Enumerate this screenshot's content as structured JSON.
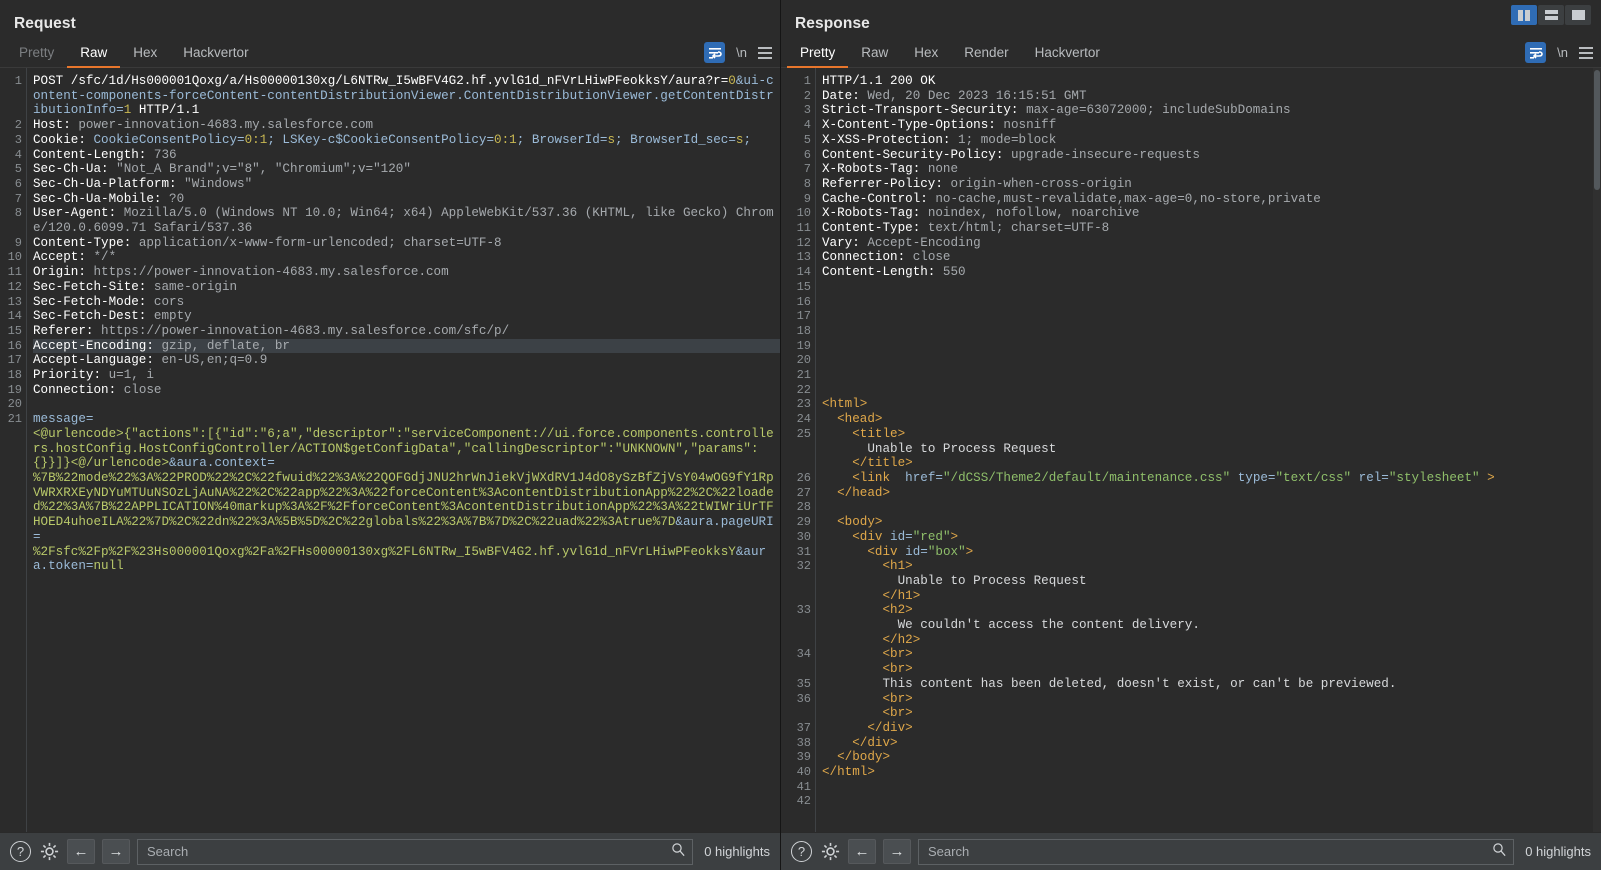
{
  "window": {
    "layout_buttons": [
      {
        "name": "split-vertical",
        "active": true
      },
      {
        "name": "split-horizontal",
        "active": false
      },
      {
        "name": "single-pane",
        "active": false
      }
    ]
  },
  "request": {
    "title": "Request",
    "tabs": [
      {
        "label": "Pretty",
        "active": false,
        "muted": true
      },
      {
        "label": "Raw",
        "active": true,
        "muted": false
      },
      {
        "label": "Hex",
        "active": false,
        "muted": false
      },
      {
        "label": "Hackvertor",
        "active": false,
        "muted": false
      }
    ],
    "tools": {
      "wrap_icon": "word-wrap-icon",
      "newline_label": "\\n",
      "menu_icon": "hamburger-menu-icon"
    },
    "search": {
      "placeholder": "Search",
      "value": "",
      "highlights": "0 highlights"
    },
    "lines": [
      {
        "n": 1,
        "segments": [
          {
            "t": "POST /sfc/1d/Hs000001Qoxg/a/Hs00000130xg/L6NTRw_I5wBFV4G2.hf.yvlG1d_nFVrLHiwPFeokksY/aura?r=",
            "c": "k"
          },
          {
            "t": "0",
            "c": "num"
          },
          {
            "t": "&ui-content-components-forceContent-contentDistributionViewer.ContentDistributionViewer.getContentDistributionInfo=",
            "c": "attr"
          },
          {
            "t": "1",
            "c": "num"
          },
          {
            "t": " HTTP/1.1",
            "c": "k"
          }
        ]
      },
      {
        "n": 2,
        "segments": [
          {
            "t": "Host: ",
            "c": "k"
          },
          {
            "t": "power-innovation-4683.my.salesforce.com",
            "c": "v"
          }
        ]
      },
      {
        "n": 3,
        "segments": [
          {
            "t": "Cookie: ",
            "c": "k"
          },
          {
            "t": "CookieConsentPolicy=",
            "c": "attr"
          },
          {
            "t": "0:1",
            "c": "num"
          },
          {
            "t": "; LSKey-c$CookieConsentPolicy=",
            "c": "attr"
          },
          {
            "t": "0:1",
            "c": "num"
          },
          {
            "t": "; BrowserId=",
            "c": "attr"
          },
          {
            "t": "s",
            "c": "num"
          },
          {
            "t": "; BrowserId_sec=",
            "c": "attr"
          },
          {
            "t": "s",
            "c": "num"
          },
          {
            "t": ";",
            "c": "attr"
          }
        ]
      },
      {
        "n": 4,
        "segments": [
          {
            "t": "Content-Length: ",
            "c": "k"
          },
          {
            "t": "736",
            "c": "v"
          }
        ]
      },
      {
        "n": 5,
        "segments": [
          {
            "t": "Sec-Ch-Ua: ",
            "c": "k"
          },
          {
            "t": "\"Not_A Brand\";v=\"8\", \"Chromium\";v=\"120\"",
            "c": "v"
          }
        ]
      },
      {
        "n": 6,
        "segments": [
          {
            "t": "Sec-Ch-Ua-Platform: ",
            "c": "k"
          },
          {
            "t": "\"Windows\"",
            "c": "v"
          }
        ]
      },
      {
        "n": 7,
        "segments": [
          {
            "t": "Sec-Ch-Ua-Mobile: ",
            "c": "k"
          },
          {
            "t": "?0",
            "c": "v"
          }
        ]
      },
      {
        "n": 8,
        "segments": [
          {
            "t": "User-Agent: ",
            "c": "k"
          },
          {
            "t": "Mozilla/5.0 (Windows NT 10.0; Win64; x64) AppleWebKit/537.36 (KHTML, like Gecko) Chrome/120.0.6099.71 Safari/537.36",
            "c": "v"
          }
        ]
      },
      {
        "n": 9,
        "segments": [
          {
            "t": "Content-Type: ",
            "c": "k"
          },
          {
            "t": "application/x-www-form-urlencoded; charset=UTF-8",
            "c": "v"
          }
        ]
      },
      {
        "n": 10,
        "segments": [
          {
            "t": "Accept: ",
            "c": "k"
          },
          {
            "t": "*/*",
            "c": "v"
          }
        ]
      },
      {
        "n": 11,
        "segments": [
          {
            "t": "Origin: ",
            "c": "k"
          },
          {
            "t": "https://power-innovation-4683.my.salesforce.com",
            "c": "v"
          }
        ]
      },
      {
        "n": 12,
        "segments": [
          {
            "t": "Sec-Fetch-Site: ",
            "c": "k"
          },
          {
            "t": "same-origin",
            "c": "v"
          }
        ]
      },
      {
        "n": 13,
        "segments": [
          {
            "t": "Sec-Fetch-Mode: ",
            "c": "k"
          },
          {
            "t": "cors",
            "c": "v"
          }
        ]
      },
      {
        "n": 14,
        "segments": [
          {
            "t": "Sec-Fetch-Dest: ",
            "c": "k"
          },
          {
            "t": "empty",
            "c": "v"
          }
        ]
      },
      {
        "n": 15,
        "segments": [
          {
            "t": "Referer: ",
            "c": "k"
          },
          {
            "t": "https://power-innovation-4683.my.salesforce.com/sfc/p/",
            "c": "v"
          }
        ]
      },
      {
        "n": 16,
        "highlight": true,
        "segments": [
          {
            "t": "Accept-Encoding: ",
            "c": "k"
          },
          {
            "t": "gzip, deflate, br",
            "c": "v"
          }
        ]
      },
      {
        "n": 17,
        "segments": [
          {
            "t": "Accept-Language: ",
            "c": "k"
          },
          {
            "t": "en-US,en;q=0.9",
            "c": "v"
          }
        ]
      },
      {
        "n": 18,
        "segments": [
          {
            "t": "Priority: ",
            "c": "k"
          },
          {
            "t": "u=1, i",
            "c": "v"
          }
        ]
      },
      {
        "n": 19,
        "segments": [
          {
            "t": "Connection: ",
            "c": "k"
          },
          {
            "t": "close",
            "c": "v"
          }
        ]
      },
      {
        "n": 20,
        "segments": []
      },
      {
        "n": 21,
        "segments": [
          {
            "t": "message=",
            "c": "attr"
          },
          {
            "t": "\n<@urlencode>{\"actions\":[{\"id\":\"6;a\",\"descriptor\":\"serviceComponent://ui.force.components.controllers.hostConfig.HostConfigController/ACTION$getConfigData\",\"callingDescriptor\":\"UNKNOWN\",\"params\":{}}]}<@/urlencode>",
            "c": "body-txt"
          },
          {
            "t": "&aura.context=",
            "c": "attr"
          },
          {
            "t": "\n%7B%22mode%22%3A%22PROD%22%2C%22fwuid%22%3A%22QOFGdjJNU2hrWnJiekVjWXdRV1J4dO8ySzBfZjVsY04wOG9fY1RpVWRXRXEyNDYuMTUuNSOzLjAuNA%22%2C%22app%22%3A%22forceContent%3AcontentDistributionApp%22%2C%22loaded%22%3A%7B%22APPLICATION%40markup%3A%2F%2FforceContent%3AcontentDistributionApp%22%3A%22tWIWriUrTFHOED4uhoeILA%22%7D%2C%22dn%22%3A%5B%5D%2C%22globals%22%3A%7B%7D%2C%22uad%22%3Atrue%7D",
            "c": "body-txt"
          },
          {
            "t": "&aura.pageURI=",
            "c": "attr"
          },
          {
            "t": "\n%2Fsfc%2Fp%2F%23Hs000001Qoxg%2Fa%2FHs00000130xg%2FL6NTRw_I5wBFV4G2.hf.yvlG1d_nFVrLHiwPFeokksY",
            "c": "body-txt"
          },
          {
            "t": "&aura.token=",
            "c": "attr"
          },
          {
            "t": "null",
            "c": "body-txt"
          }
        ]
      }
    ]
  },
  "response": {
    "title": "Response",
    "tabs": [
      {
        "label": "Pretty",
        "active": true,
        "muted": false
      },
      {
        "label": "Raw",
        "active": false,
        "muted": false
      },
      {
        "label": "Hex",
        "active": false,
        "muted": false
      },
      {
        "label": "Render",
        "active": false,
        "muted": false
      },
      {
        "label": "Hackvertor",
        "active": false,
        "muted": false
      }
    ],
    "tools": {
      "wrap_icon": "word-wrap-icon",
      "newline_label": "\\n",
      "menu_icon": "hamburger-menu-icon"
    },
    "search": {
      "placeholder": "Search",
      "value": "",
      "highlights": "0 highlights"
    },
    "lines": [
      {
        "n": 1,
        "segments": [
          {
            "t": "HTTP/1.1 ",
            "c": "k"
          },
          {
            "t": "200",
            "c": "k"
          },
          {
            "t": " OK",
            "c": "k"
          }
        ]
      },
      {
        "n": 2,
        "segments": [
          {
            "t": "Date: ",
            "c": "k"
          },
          {
            "t": "Wed, 20 Dec 2023 16:15:51 GMT",
            "c": "v"
          }
        ]
      },
      {
        "n": 3,
        "segments": [
          {
            "t": "Strict-Transport-Security: ",
            "c": "k"
          },
          {
            "t": "max-age=63072000; includeSubDomains",
            "c": "v"
          }
        ]
      },
      {
        "n": 4,
        "segments": [
          {
            "t": "X-Content-Type-Options: ",
            "c": "k"
          },
          {
            "t": "nosniff",
            "c": "v"
          }
        ]
      },
      {
        "n": 5,
        "segments": [
          {
            "t": "X-XSS-Protection: ",
            "c": "k"
          },
          {
            "t": "1; mode=block",
            "c": "v"
          }
        ]
      },
      {
        "n": 6,
        "segments": [
          {
            "t": "Content-Security-Policy: ",
            "c": "k"
          },
          {
            "t": "upgrade-insecure-requests",
            "c": "v"
          }
        ]
      },
      {
        "n": 7,
        "segments": [
          {
            "t": "X-Robots-Tag: ",
            "c": "k"
          },
          {
            "t": "none",
            "c": "v"
          }
        ]
      },
      {
        "n": 8,
        "segments": [
          {
            "t": "Referrer-Policy: ",
            "c": "k"
          },
          {
            "t": "origin-when-cross-origin",
            "c": "v"
          }
        ]
      },
      {
        "n": 9,
        "segments": [
          {
            "t": "Cache-Control: ",
            "c": "k"
          },
          {
            "t": "no-cache,must-revalidate,max-age=0,no-store,private",
            "c": "v"
          }
        ]
      },
      {
        "n": 10,
        "segments": [
          {
            "t": "X-Robots-Tag: ",
            "c": "k"
          },
          {
            "t": "noindex, nofollow, noarchive",
            "c": "v"
          }
        ]
      },
      {
        "n": 11,
        "segments": [
          {
            "t": "Content-Type: ",
            "c": "k"
          },
          {
            "t": "text/html; charset=UTF-8",
            "c": "v"
          }
        ]
      },
      {
        "n": 12,
        "segments": [
          {
            "t": "Vary: ",
            "c": "k"
          },
          {
            "t": "Accept-Encoding",
            "c": "v"
          }
        ]
      },
      {
        "n": 13,
        "segments": [
          {
            "t": "Connection: ",
            "c": "k"
          },
          {
            "t": "close",
            "c": "v"
          }
        ]
      },
      {
        "n": 14,
        "segments": [
          {
            "t": "Content-Length: ",
            "c": "k"
          },
          {
            "t": "550",
            "c": "v"
          }
        ]
      },
      {
        "n": 15,
        "segments": []
      },
      {
        "n": 16,
        "segments": []
      },
      {
        "n": 17,
        "segments": []
      },
      {
        "n": 18,
        "segments": []
      },
      {
        "n": 19,
        "segments": []
      },
      {
        "n": 20,
        "segments": []
      },
      {
        "n": 21,
        "segments": []
      },
      {
        "n": 22,
        "segments": []
      },
      {
        "n": 23,
        "segments": [
          {
            "t": "<html>",
            "c": "tag"
          }
        ]
      },
      {
        "n": 24,
        "segments": [
          {
            "t": "  <head>",
            "c": "tag"
          }
        ]
      },
      {
        "n": 25,
        "segments": [
          {
            "t": "    <title>",
            "c": "tag"
          },
          {
            "t": "\n      Unable to Process Request",
            "c": "txt"
          },
          {
            "t": "\n    </title>",
            "c": "tag"
          }
        ]
      },
      {
        "n": 26,
        "segments": [
          {
            "t": "    <link ",
            "c": "tag"
          },
          {
            "t": " href=",
            "c": "attr"
          },
          {
            "t": "\"/dCSS/Theme2/default/maintenance.css\"",
            "c": "str"
          },
          {
            "t": " type=",
            "c": "attr"
          },
          {
            "t": "\"text/css\"",
            "c": "str"
          },
          {
            "t": " rel=",
            "c": "attr"
          },
          {
            "t": "\"stylesheet\"",
            "c": "str"
          },
          {
            "t": " >",
            "c": "tag"
          }
        ]
      },
      {
        "n": 27,
        "segments": [
          {
            "t": "  </head>",
            "c": "tag"
          }
        ]
      },
      {
        "n": 28,
        "segments": []
      },
      {
        "n": 29,
        "segments": [
          {
            "t": "  <body>",
            "c": "tag"
          }
        ]
      },
      {
        "n": 30,
        "segments": [
          {
            "t": "    <div ",
            "c": "tag"
          },
          {
            "t": "id=",
            "c": "attr"
          },
          {
            "t": "\"red\"",
            "c": "str"
          },
          {
            "t": ">",
            "c": "tag"
          }
        ]
      },
      {
        "n": 31,
        "segments": [
          {
            "t": "      <div ",
            "c": "tag"
          },
          {
            "t": "id=",
            "c": "attr"
          },
          {
            "t": "\"box\"",
            "c": "str"
          },
          {
            "t": ">",
            "c": "tag"
          }
        ]
      },
      {
        "n": 32,
        "segments": [
          {
            "t": "        <h1>",
            "c": "tag"
          },
          {
            "t": "\n          Unable to Process Request",
            "c": "txt"
          },
          {
            "t": "\n        </h1>",
            "c": "tag"
          }
        ]
      },
      {
        "n": 33,
        "segments": [
          {
            "t": "        <h2>",
            "c": "tag"
          },
          {
            "t": "\n          We couldn't access the content delivery.",
            "c": "txt"
          },
          {
            "t": "\n        </h2>",
            "c": "tag"
          }
        ]
      },
      {
        "n": 34,
        "segments": [
          {
            "t": "        <br>",
            "c": "tag"
          },
          {
            "t": "\n        <br>",
            "c": "tag"
          }
        ]
      },
      {
        "n": 35,
        "segments": [
          {
            "t": "        This content has been deleted, doesn't exist, or can't be previewed.",
            "c": "txt"
          }
        ]
      },
      {
        "n": 36,
        "segments": [
          {
            "t": "        <br>",
            "c": "tag"
          },
          {
            "t": "\n        <br>",
            "c": "tag"
          }
        ]
      },
      {
        "n": 37,
        "segments": [
          {
            "t": "      </div>",
            "c": "tag"
          }
        ]
      },
      {
        "n": 38,
        "segments": [
          {
            "t": "    </div>",
            "c": "tag"
          }
        ]
      },
      {
        "n": 39,
        "segments": [
          {
            "t": "  </body>",
            "c": "tag"
          }
        ]
      },
      {
        "n": 40,
        "segments": [
          {
            "t": "</html>",
            "c": "tag"
          }
        ]
      },
      {
        "n": 41,
        "segments": []
      },
      {
        "n": 42,
        "segments": []
      }
    ]
  }
}
